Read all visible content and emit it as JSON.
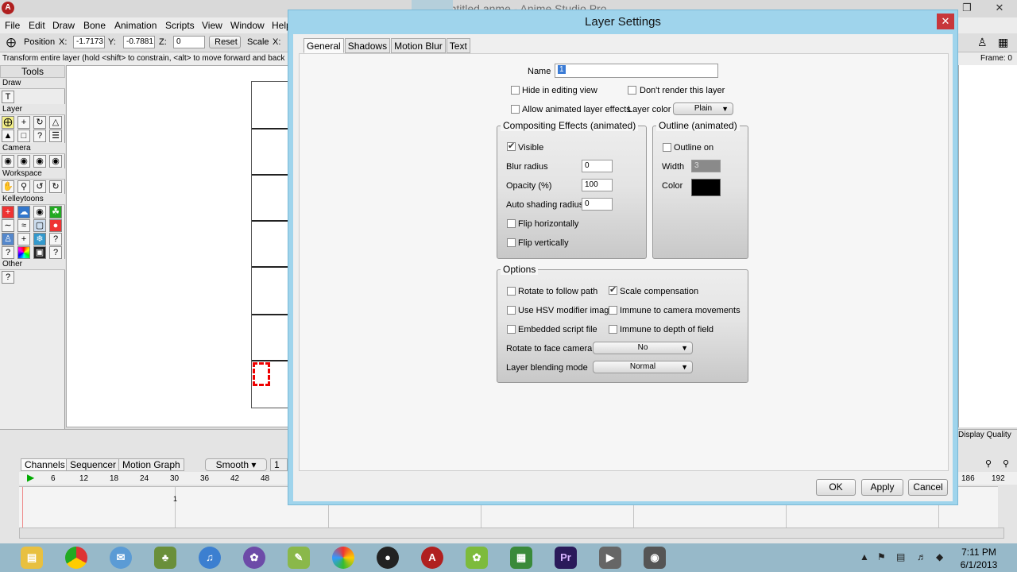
{
  "app": {
    "title": "Untitled.anme - Anime Studio Pro",
    "menus": [
      "File",
      "Edit",
      "Draw",
      "Bone",
      "Animation",
      "Scripts",
      "View",
      "Window",
      "Help"
    ]
  },
  "tool_options": {
    "position_label": "Position",
    "x_label": "X:",
    "x_value": "-1.7173",
    "y_label": "Y:",
    "y_value": "-0.7881",
    "z_label": "Z:",
    "z_value": "0",
    "reset_label": "Reset",
    "scale_label": "Scale",
    "scale_x_label": "X:"
  },
  "hint": "Transform entire layer (hold <shift> to constrain, <alt> to move forward and back",
  "frame_readout": "Frame: 0",
  "tools": {
    "title": "Tools",
    "groups": [
      "Draw",
      "Layer",
      "Camera",
      "Workspace",
      "Kelleytoons",
      "Other"
    ]
  },
  "timeline": {
    "tabs": [
      "Channels",
      "Sequencer",
      "Motion Graph"
    ],
    "smooth_label": "Smooth",
    "interp_value": "1",
    "ruler_ticks": [
      "6",
      "12",
      "18",
      "24",
      "30",
      "36",
      "42",
      "48"
    ],
    "right_ticks": [
      "186",
      "192"
    ],
    "marker": "1",
    "display_quality": "Display Quality"
  },
  "taskbar": {
    "time": "7:11 PM",
    "date": "6/1/2013"
  },
  "dialog": {
    "title": "Layer Settings",
    "tabs": [
      "General",
      "Shadows",
      "Motion Blur",
      "Text"
    ],
    "name_label": "Name",
    "name_value": "1",
    "hide_in_editing": "Hide in editing view",
    "dont_render": "Don't render this layer",
    "allow_animated": "Allow animated layer effects",
    "layer_color_label": "Layer color",
    "layer_color_value": "Plain",
    "compositing": {
      "title": "Compositing Effects (animated)",
      "visible": "Visible",
      "visible_checked": true,
      "blur_label": "Blur radius",
      "blur_value": "0",
      "opacity_label": "Opacity (%)",
      "opacity_value": "100",
      "auto_shading_label": "Auto shading radius",
      "auto_shading_value": "0",
      "flip_h": "Flip horizontally",
      "flip_v": "Flip vertically"
    },
    "outline": {
      "title": "Outline (animated)",
      "outline_on": "Outline on",
      "width_label": "Width",
      "width_value": "3",
      "color_label": "Color",
      "color_value": "#000000"
    },
    "options": {
      "title": "Options",
      "rotate_follow_path": "Rotate to follow path",
      "scale_compensation": "Scale compensation",
      "scale_compensation_checked": true,
      "use_hsv": "Use HSV modifier image",
      "immune_camera": "Immune to camera movements",
      "embedded_script": "Embedded script file",
      "immune_dof": "Immune to depth of field",
      "rotate_face_label": "Rotate to face camera",
      "rotate_face_value": "No",
      "blending_label": "Layer blending mode",
      "blending_value": "Normal"
    },
    "buttons": {
      "ok": "OK",
      "apply": "Apply",
      "cancel": "Cancel"
    }
  }
}
